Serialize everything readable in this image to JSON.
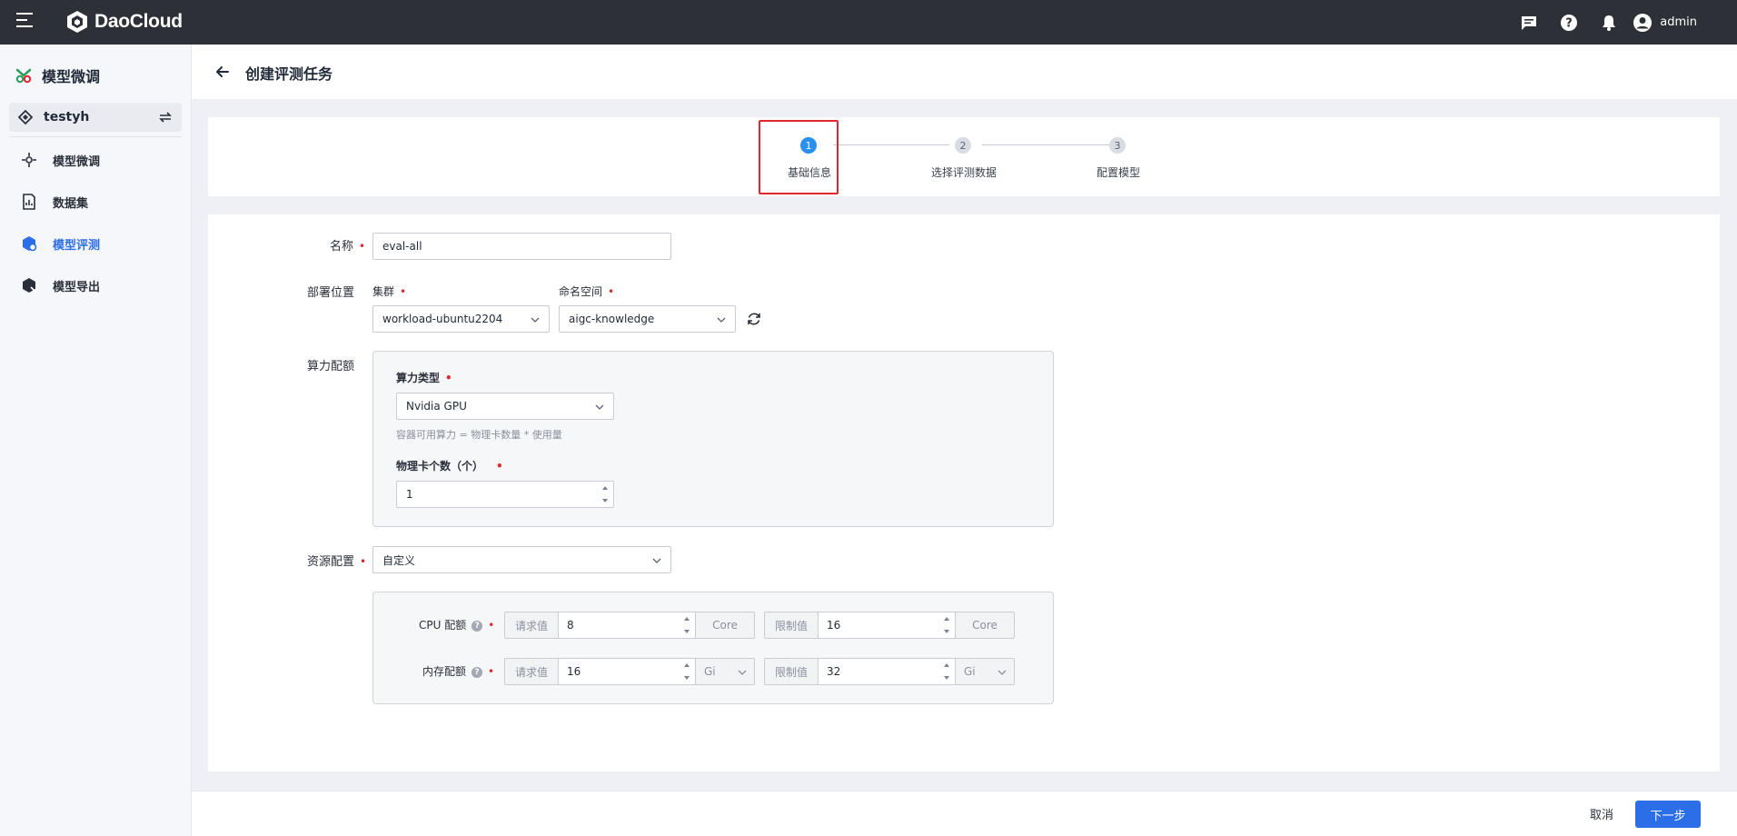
{
  "topbar": {
    "brand": "DaoCloud",
    "user": "admin"
  },
  "sidebar": {
    "title": "模型微调",
    "workspace": "testyh",
    "items": [
      {
        "label": "模型微调",
        "active": false
      },
      {
        "label": "数据集",
        "active": false
      },
      {
        "label": "模型评测",
        "active": true
      },
      {
        "label": "模型导出",
        "active": false
      }
    ]
  },
  "header": {
    "title": "创建评测任务"
  },
  "steps": [
    {
      "num": "1",
      "label": "基础信息",
      "state": "current"
    },
    {
      "num": "2",
      "label": "选择评测数据",
      "state": "todo"
    },
    {
      "num": "3",
      "label": "配置模型",
      "state": "todo"
    }
  ],
  "form": {
    "name": {
      "label": "名称",
      "value": "eval-all"
    },
    "deploy": {
      "label": "部署位置",
      "cluster_label": "集群",
      "cluster_value": "workload-ubuntu2204",
      "namespace_label": "命名空间",
      "namespace_value": "aigc-knowledge"
    },
    "compute": {
      "label": "算力配额",
      "type_label": "算力类型",
      "type_value": "Nvidia GPU",
      "hint": "容器可用算力 = 物理卡数量 * 使用量",
      "count_label": "物理卡个数（个）",
      "count_value": "1"
    },
    "resource": {
      "label": "资源配置",
      "value": "自定义",
      "cpu": {
        "label": "CPU 配额",
        "req_label": "请求值",
        "req_value": "8",
        "unit": "Core",
        "lim_label": "限制值",
        "lim_value": "16",
        "lim_unit": "Core"
      },
      "mem": {
        "label": "内存配额",
        "req_label": "请求值",
        "req_value": "16",
        "unit": "Gi",
        "lim_label": "限制值",
        "lim_value": "32",
        "lim_unit": "Gi"
      }
    }
  },
  "footer": {
    "cancel": "取消",
    "next": "下一步"
  },
  "colors": {
    "primary": "#2b6ee8",
    "step_active": "#2b8ff0",
    "highlight": "#e0262c",
    "topbar": "#2d3036"
  }
}
